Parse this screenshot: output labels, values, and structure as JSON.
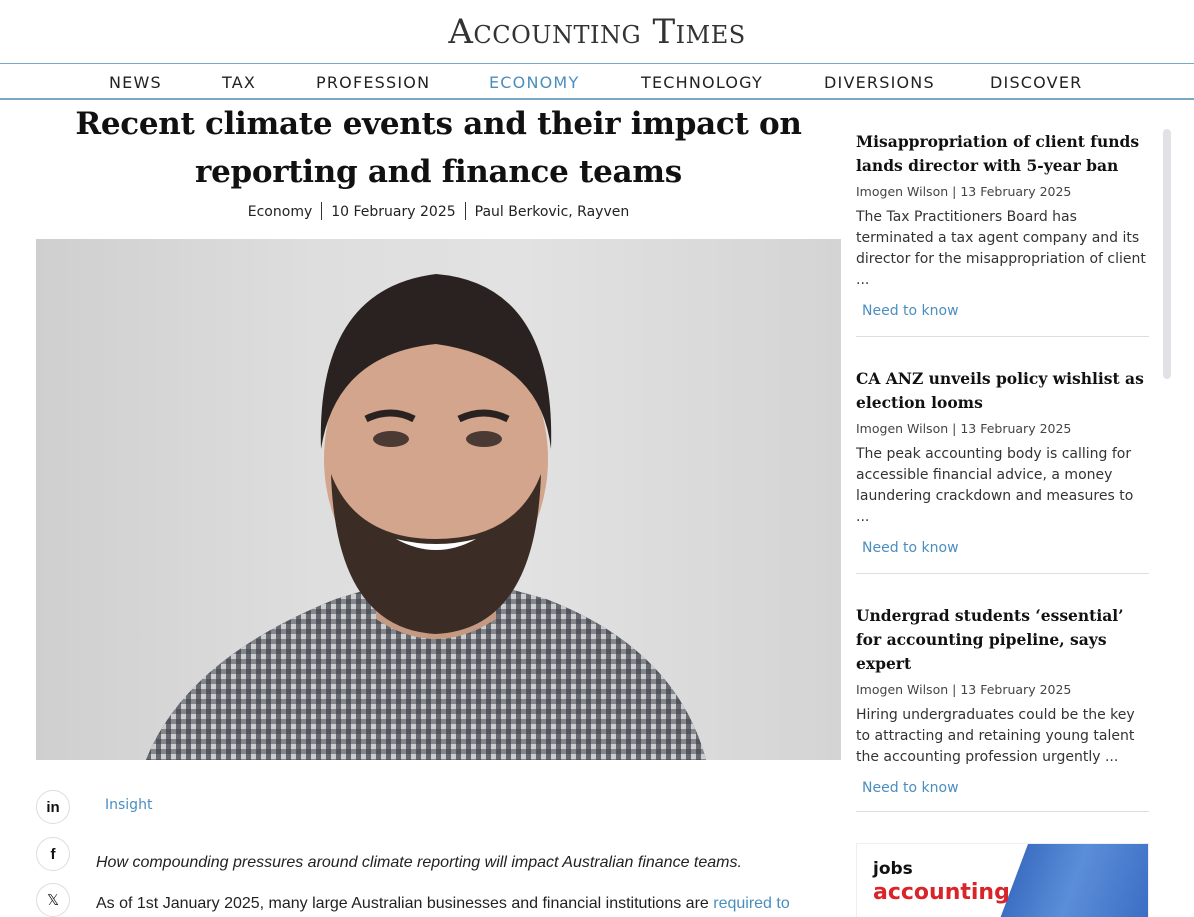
{
  "site": {
    "logo": "Accounting Times"
  },
  "nav": {
    "items": [
      {
        "label": "NEWS"
      },
      {
        "label": "TAX"
      },
      {
        "label": "PROFESSION"
      },
      {
        "label": "ECONOMY"
      },
      {
        "label": "TECHNOLOGY"
      },
      {
        "label": "DIVERSIONS"
      },
      {
        "label": "DISCOVER"
      }
    ],
    "active_color": "#4a8ec0"
  },
  "article": {
    "title": "Recent climate events and their impact on reporting and finance teams",
    "category": "Economy",
    "date": "10 February 2025",
    "author": "Paul Berkovic, Rayven",
    "tag": "Insight",
    "lede": "How compounding pressures around climate reporting will impact Australian finance teams.",
    "body_start": "As of 1st January 2025, many large Australian businesses and financial institutions are ",
    "body_link": "required to"
  },
  "share": {
    "linkedin": "in",
    "facebook": "f",
    "x": "𝕏"
  },
  "sidebar": {
    "cards": [
      {
        "title": "Misappropriation of client funds lands director with 5-year ban",
        "author": "Imogen Wilson",
        "date": "13 February 2025",
        "summary": "The Tax Practitioners Board has terminated a tax agent company and its director for the misappropriation of client ...",
        "link": "Need to know"
      },
      {
        "title": "CA ANZ unveils policy wishlist as election looms",
        "author": "Imogen Wilson",
        "date": "13 February 2025",
        "summary": "The peak accounting body is calling for accessible financial advice, a money laundering crackdown and measures to ...",
        "link": "Need to know"
      },
      {
        "title": "Undergrad students ‘essential’ for accounting pipeline, says expert",
        "author": "Imogen Wilson",
        "date": "13 February 2025",
        "summary": "Hiring undergraduates could be the key to attracting and retaining young talent the accounting profession urgently ...",
        "link": "Need to know"
      }
    ],
    "ad": {
      "line1": "jobs",
      "line2": "accounting"
    }
  }
}
